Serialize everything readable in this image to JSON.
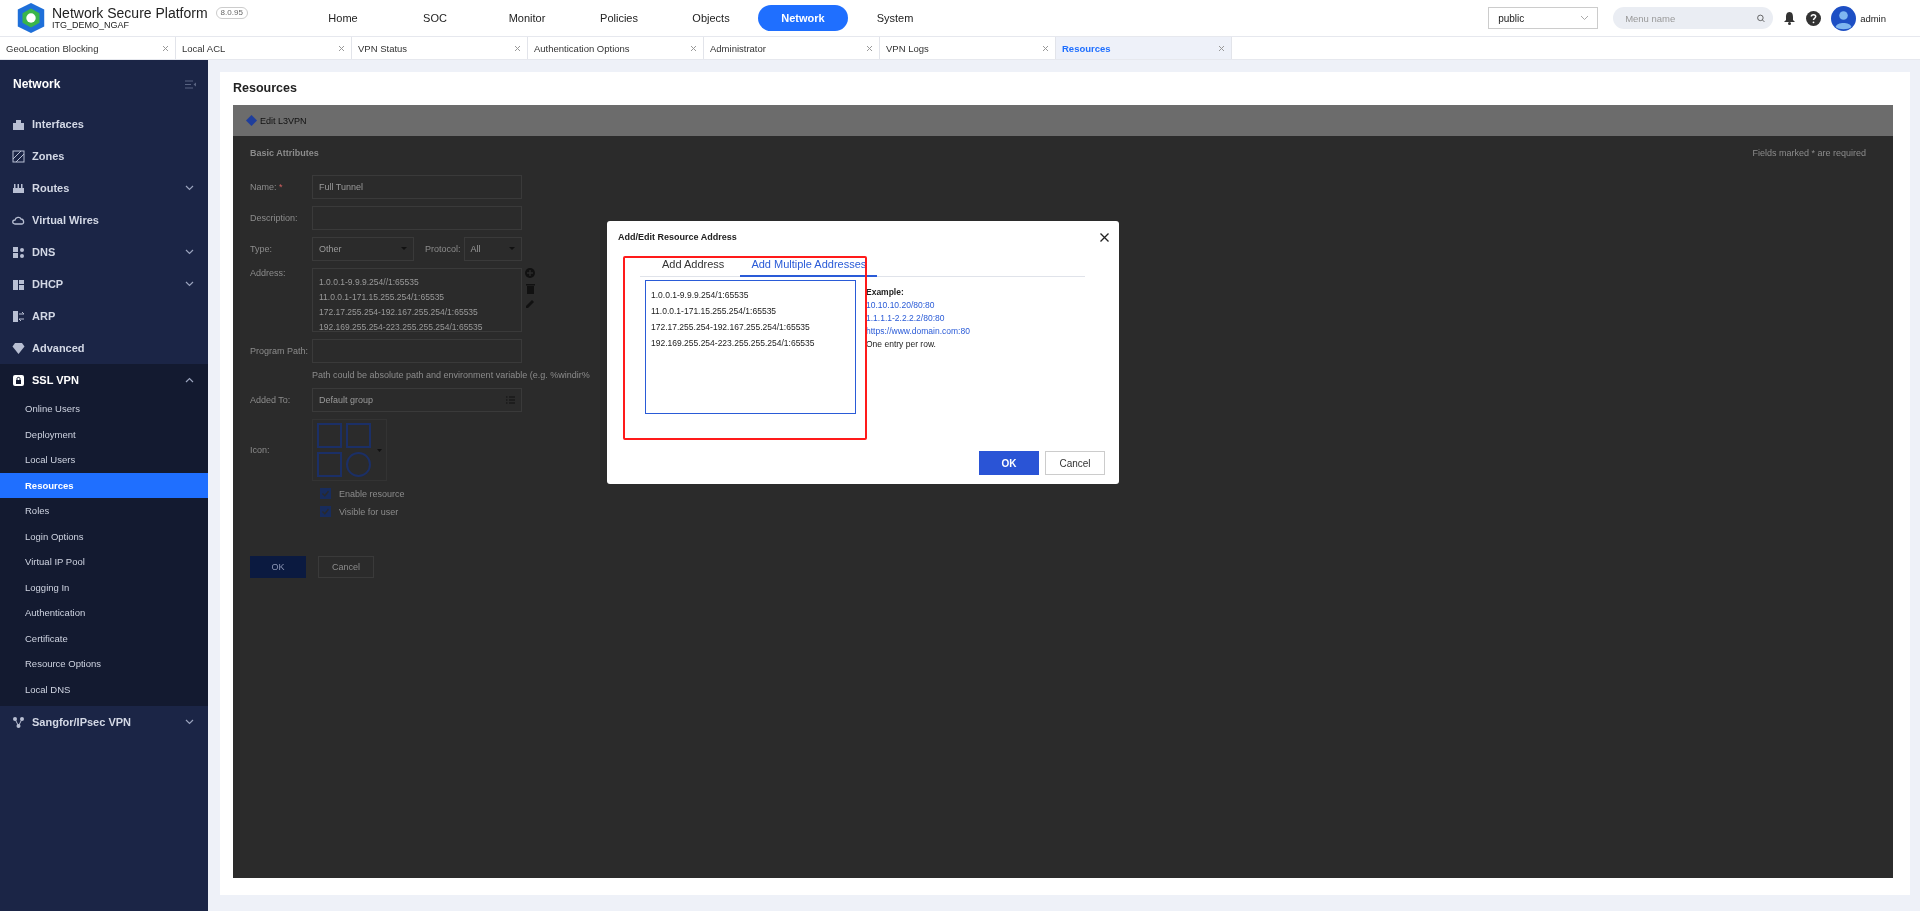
{
  "header": {
    "title": "Network Secure Platform",
    "subtitle": "ITG_DEMO_NGAF",
    "version": "8.0.95",
    "nav": [
      {
        "label": "Home",
        "selected": false
      },
      {
        "label": "SOC",
        "selected": false
      },
      {
        "label": "Monitor",
        "selected": false
      },
      {
        "label": "Policies",
        "selected": false
      },
      {
        "label": "Objects",
        "selected": false
      },
      {
        "label": "Network",
        "selected": true
      },
      {
        "label": "System",
        "selected": false
      }
    ],
    "domain_select": {
      "value": "public"
    },
    "search": {
      "placeholder": "Menu name"
    },
    "user": {
      "name": "admin"
    }
  },
  "page_tabs": [
    {
      "label": "GeoLocation Blocking",
      "selected": false
    },
    {
      "label": "Local ACL",
      "selected": false
    },
    {
      "label": "VPN Status",
      "selected": false
    },
    {
      "label": "Authentication Options",
      "selected": false
    },
    {
      "label": "Administrator",
      "selected": false
    },
    {
      "label": "VPN Logs",
      "selected": false
    },
    {
      "label": "Resources",
      "selected": true
    }
  ],
  "sidebar": {
    "title": "Network",
    "items": [
      {
        "label": "Interfaces",
        "kind": "link"
      },
      {
        "label": "Zones",
        "kind": "link"
      },
      {
        "label": "Routes",
        "kind": "group",
        "expanded": false
      },
      {
        "label": "Virtual Wires",
        "kind": "link"
      },
      {
        "label": "DNS",
        "kind": "group",
        "expanded": false
      },
      {
        "label": "DHCP",
        "kind": "group",
        "expanded": false
      },
      {
        "label": "ARP",
        "kind": "link"
      },
      {
        "label": "Advanced",
        "kind": "link"
      },
      {
        "label": "SSL VPN",
        "kind": "group",
        "expanded": true,
        "children": [
          {
            "label": "Online Users",
            "selected": false
          },
          {
            "label": "Deployment",
            "selected": false
          },
          {
            "label": "Local Users",
            "selected": false
          },
          {
            "label": "Resources",
            "selected": true
          },
          {
            "label": "Roles",
            "selected": false
          },
          {
            "label": "Login Options",
            "selected": false
          },
          {
            "label": "Virtual IP Pool",
            "selected": false
          },
          {
            "label": "Logging In",
            "selected": false
          },
          {
            "label": "Authentication",
            "selected": false
          },
          {
            "label": "Certificate",
            "selected": false
          },
          {
            "label": "Resource Options",
            "selected": false
          },
          {
            "label": "Local DNS",
            "selected": false
          }
        ]
      },
      {
        "label": "Sangfor/IPsec VPN",
        "kind": "group",
        "expanded": false
      }
    ]
  },
  "page_title": "Resources",
  "panel": {
    "title": "Edit L3VPN",
    "section": "Basic Attributes",
    "required_note": "Fields marked * are required",
    "form": {
      "name": {
        "label": "Name:",
        "required_mark": "*",
        "value": "Full Tunnel"
      },
      "description": {
        "label": "Description:"
      },
      "type": {
        "label": "Type:",
        "value": "Other"
      },
      "protocol": {
        "label": "Protocol:",
        "value": "All"
      },
      "address": {
        "label": "Address:",
        "lines": [
          "1.0.0.1-9.9.9.254//1:65535",
          "11.0.0.1-171.15.255.254/1:65535",
          "172.17.255.254-192.167.255.254/1:65535",
          "192.169.255.254-223.255.255.254/1:65535"
        ]
      },
      "program_path": {
        "label": "Program Path:",
        "hint": "Path could be absolute path and environment variable (e.g. %windir%"
      },
      "added_to": {
        "label": "Added To:",
        "value": "Default group"
      },
      "icon": {
        "label": "Icon:"
      },
      "options": [
        {
          "label": "Enable resource",
          "checked": true
        },
        {
          "label": "Visible for user",
          "checked": true
        }
      ],
      "buttons": [
        "OK",
        "Cancel"
      ]
    }
  },
  "modal": {
    "title": "Add/Edit Resource Address",
    "tabs": [
      {
        "label": "Add Address",
        "selected": false
      },
      {
        "label": "Add Multiple Addresses",
        "selected": true
      }
    ],
    "addresses": [
      "1.0.0.1-9.9.9.254/1:65535",
      "11.0.0.1-171.15.255.254/1:65535",
      "172.17.255.254-192.167.255.254/1:65535",
      "192.169.255.254-223.255.255.254/1:65535"
    ],
    "example": {
      "heading": "Example:",
      "samples": [
        "10.10.10.20/80:80",
        "1.1.1.1-2.2.2.2/80:80",
        "https://www.domain.com:80"
      ],
      "note": "One entry per row."
    },
    "buttons": [
      "OK",
      "Cancel"
    ]
  }
}
